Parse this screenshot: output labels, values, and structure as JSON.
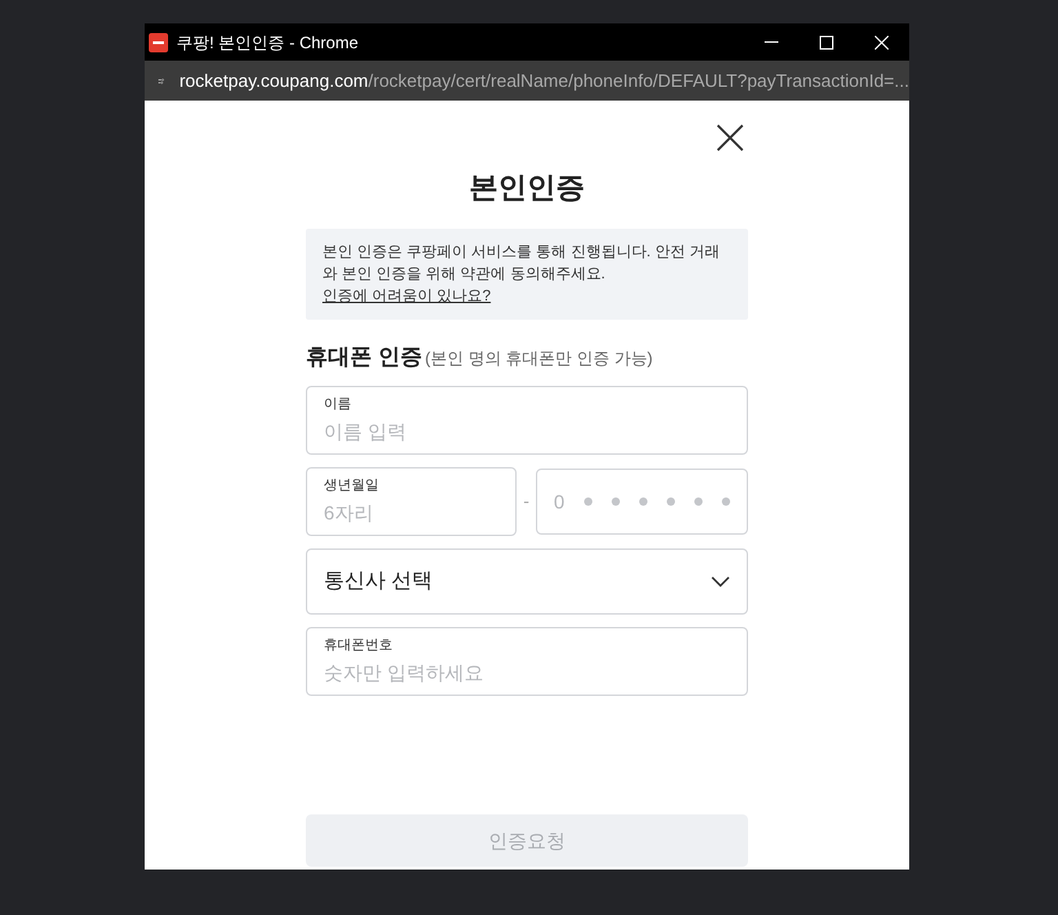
{
  "window": {
    "title": "쿠팡! 본인인증 - Chrome",
    "url_host": "rocketpay.coupang.com",
    "url_path": "/rocketpay/cert/realName/phoneInfo/DEFAULT?payTransactionId=..."
  },
  "dialog": {
    "title": "본인인증",
    "notice": {
      "text": "본인 인증은 쿠팡페이 서비스를 통해 진행됩니다. 안전 거래와 본인 인증을 위해 약관에 동의해주세요. ",
      "link": "인증에 어려움이 있나요?"
    },
    "section": {
      "title": "휴대폰 인증",
      "note": "(본인 명의 휴대폰만 인증 가능)"
    },
    "name_field": {
      "label": "이름",
      "placeholder": "이름 입력"
    },
    "birth_field": {
      "label": "생년월일",
      "placeholder": "6자리"
    },
    "separator": "-",
    "id_back_field": {
      "value": "0"
    },
    "carrier_select": {
      "value": "통신사 선택"
    },
    "phone_field": {
      "label": "휴대폰번호",
      "placeholder": "숫자만 입력하세요"
    },
    "submit": {
      "label": "인증요청",
      "disabled": true
    }
  }
}
